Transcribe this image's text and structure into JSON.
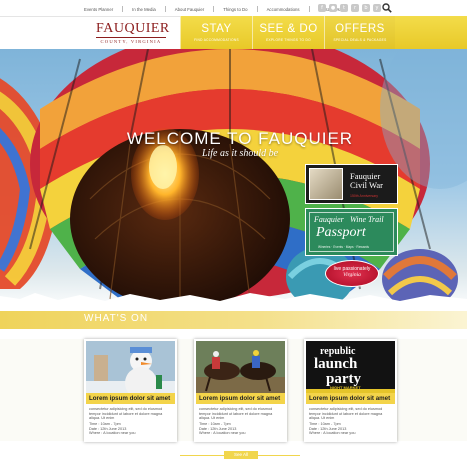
{
  "topnav": {
    "items": [
      "Events Planner",
      "In the Media",
      "About Fauquier",
      "Things to Do",
      "Accommodations",
      "Contact Us"
    ]
  },
  "social": {
    "icons": [
      "facebook-icon",
      "flickr-icon",
      "twitter-icon",
      "rss-icon",
      "blog-icon",
      "youtube-icon"
    ],
    "glyphs": [
      "f",
      "●",
      "t",
      "r",
      "b",
      "y"
    ]
  },
  "logo": {
    "main": "FAUQUIER",
    "sub": "COUNTY, VIRGINIA"
  },
  "mainnav": [
    {
      "label": "STAY",
      "sub": "FIND ACCOMMODATIONS"
    },
    {
      "label": "SEE & DO",
      "sub": "EXPLORE THINGS TO DO"
    },
    {
      "label": "OFFERS",
      "sub": "SPECIAL DEALS & PACKAGES"
    }
  ],
  "hero": {
    "title": "WELCOME TO FAUQUIER",
    "subtitle": "Life as it should be"
  },
  "promos": {
    "civil_war": {
      "line1": "Fauquier",
      "line2": "Civil War",
      "note": "150th Anniversary"
    },
    "wine": {
      "line1": "Fauquier",
      "line2": "Wine Trail",
      "line3": "Passport",
      "note": "Wineries · Events · Maps · Rewards"
    },
    "va": {
      "line1": "live passionately",
      "line2": "Virginia"
    }
  },
  "whats_on": {
    "title": "WHAT'S ON"
  },
  "events": [
    {
      "title": "Lorem ipsum dolor sit amet",
      "desc": "consectetur adipisicing elit, sed do eiusmod tempor incididunt ut labore et dolore magna aliqua. Ut enim",
      "time": "Time : 10am - 7pm",
      "date": "Date : 12th June 2013",
      "where": "Where : A location near you"
    },
    {
      "title": "Lorem ipsum dolor sit amet",
      "desc": "consectetur adipisicing elit, sed do eiusmod tempor incididunt ut labore et dolore magna aliqua. Ut enim",
      "time": "Time : 10am - 7pm",
      "date": "Date : 12th June 2013",
      "where": "Where : A location near you"
    },
    {
      "title": "Lorem ipsum dolor sit amet",
      "desc": "consectetur adipisicing elit, sed do eiusmod tempor incididunt ut labore et dolore magna aliqua. Ut enim",
      "time": "Time : 10am - 7pm",
      "date": "Date : 12th June 2013",
      "where": "Where : A location near you"
    }
  ],
  "event3_poster": {
    "line1": "republic",
    "line2": "launch",
    "line3": "party",
    "line4": "NIGHT MARKET"
  },
  "see_all": "See All",
  "colors": {
    "accent": "#efd34a",
    "brand": "#8c1d1d",
    "wine_green": "#2c8a5c",
    "va_red": "#c31a34"
  }
}
